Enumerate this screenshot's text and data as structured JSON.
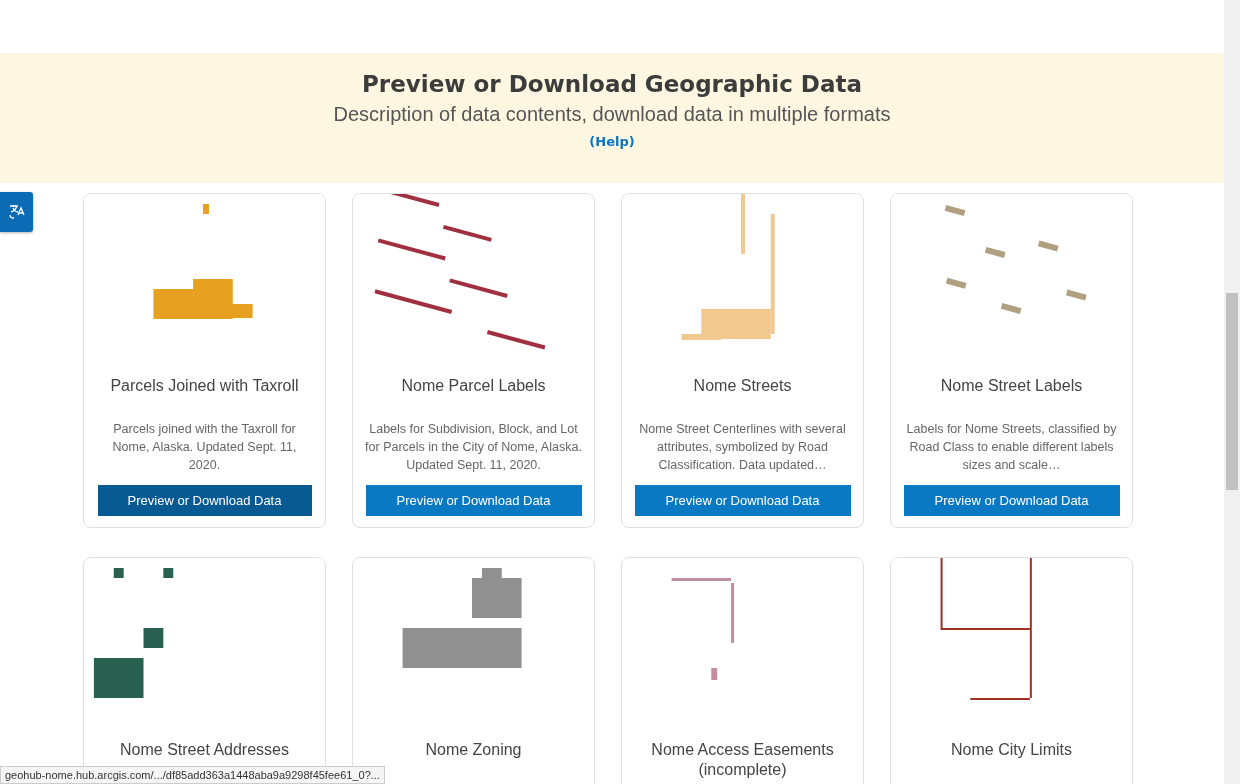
{
  "banner": {
    "title": "Preview or Download Geographic Data",
    "subtitle": "Description of data contents, download data in multiple formats",
    "help_link": "(Help)"
  },
  "cards": [
    {
      "title": "Parcels Joined with Taxroll",
      "description": "Parcels joined with the Taxroll for Nome, Alaska. Updated Sept. 11, 2020.",
      "button": "Preview or Download Data",
      "hovered": true
    },
    {
      "title": "Nome Parcel Labels",
      "description": "Labels for Subdivision, Block, and Lot for Parcels in the City of Nome, Alaska. Updated Sept. 11, 2020.",
      "button": "Preview or Download Data",
      "hovered": false
    },
    {
      "title": "Nome Streets",
      "description": "Nome Street Centerlines with several attributes, symbolized by Road Classification. Data updated…",
      "button": "Preview or Download Data",
      "hovered": false
    },
    {
      "title": "Nome Street Labels",
      "description": "Labels for Nome Streets, classified by Road Class to enable different labels sizes and scale…",
      "button": "Preview or Download Data",
      "hovered": false
    },
    {
      "title": "Nome Street Addresses"
    },
    {
      "title": "Nome Zoning"
    },
    {
      "title": "Nome Access Easements (incomplete)"
    },
    {
      "title": "Nome City Limits"
    }
  ],
  "status_url": "geohub-nome.hub.arcgis.com/.../df85add363a1448aba9a9298f45fee61_0?..."
}
